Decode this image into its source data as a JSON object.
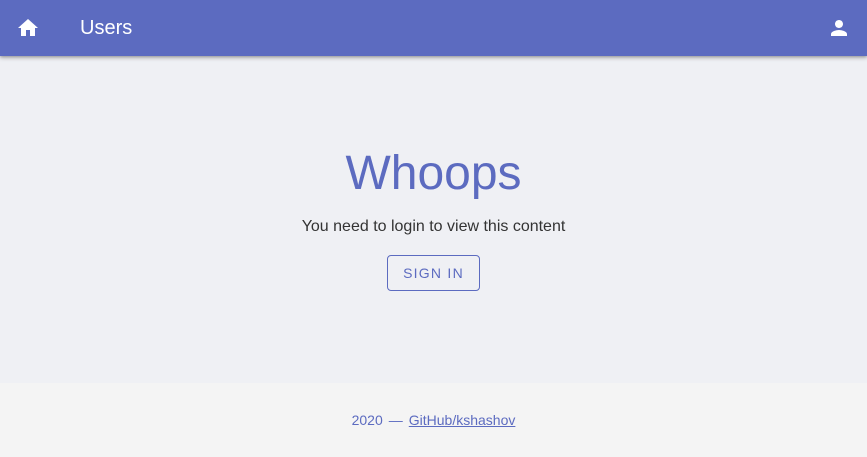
{
  "header": {
    "title": "Users",
    "home_icon": "home-icon",
    "account_icon": "account-icon",
    "background_color": "#5c6bc0"
  },
  "main": {
    "headline": "Whoops",
    "message": "You need to login to view this content",
    "signin_label": "SIGN IN",
    "accent_color": "#5c6bc0"
  },
  "footer": {
    "year": "2020",
    "separator": "—",
    "link_text": "GitHub/kshashov"
  }
}
